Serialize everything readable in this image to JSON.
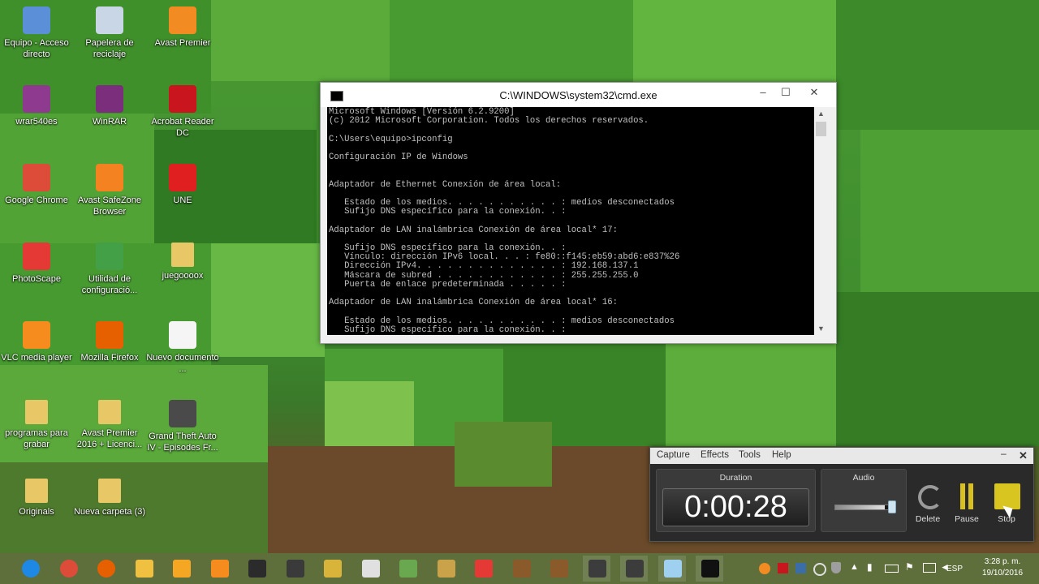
{
  "desktop": {
    "icons": [
      {
        "label": "Equipo - Acceso directo",
        "icon": "computer-icon",
        "color": "#5b8fd8"
      },
      {
        "label": "Papelera de reciclaje",
        "icon": "recycle-bin-icon",
        "color": "#c9d6e6"
      },
      {
        "label": "Avast Premier",
        "icon": "avast-icon",
        "color": "#f28b22"
      },
      {
        "label": "wrar540es",
        "icon": "winrar-installer-icon",
        "color": "#8e3b8f"
      },
      {
        "label": "WinRAR",
        "icon": "winrar-icon",
        "color": "#7a2e7c"
      },
      {
        "label": "Acrobat Reader DC",
        "icon": "acrobat-icon",
        "color": "#c9151e"
      },
      {
        "label": "Google Chrome",
        "icon": "chrome-icon",
        "color": "#dd4b39"
      },
      {
        "label": "Avast SafeZone Browser",
        "icon": "safezone-icon",
        "color": "#f58220"
      },
      {
        "label": "UNE",
        "icon": "une-icon",
        "color": "#e02020"
      },
      {
        "label": "PhotoScape",
        "icon": "photoscape-icon",
        "color": "#e53935"
      },
      {
        "label": "Utilidad de configuració...",
        "icon": "wifi-utility-icon",
        "color": "#43a047"
      },
      {
        "label": "juegoooox",
        "icon": "folder-icon",
        "color": "#e8c766"
      },
      {
        "label": "VLC media player",
        "icon": "vlc-icon",
        "color": "#f78c1e"
      },
      {
        "label": "Mozilla Firefox",
        "icon": "firefox-icon",
        "color": "#e66000"
      },
      {
        "label": "Nuevo documento ...",
        "icon": "text-document-icon",
        "color": "#f5f5f5"
      },
      {
        "label": "programas para grabar",
        "icon": "folder-icon",
        "color": "#e8c766"
      },
      {
        "label": "Avast Premier 2016 + Licenci...",
        "icon": "folder-icon",
        "color": "#e8c766"
      },
      {
        "label": "Grand Theft Auto IV - Episodes Fr...",
        "icon": "gta-icon",
        "color": "#4a4a4a"
      },
      {
        "label": "Originals",
        "icon": "folder-icon",
        "color": "#e8c766"
      },
      {
        "label": "Nueva carpeta (3)",
        "icon": "folder-icon",
        "color": "#e8c766"
      }
    ]
  },
  "cmd": {
    "title": "C:\\WINDOWS\\system32\\cmd.exe",
    "minimize": "‒",
    "maximize": "☐",
    "close": "✕",
    "lines": [
      "Microsoft Windows [Versión 6.2.9200]",
      "(c) 2012 Microsoft Corporation. Todos los derechos reservados.",
      "",
      "C:\\Users\\equipo>ipconfig",
      "",
      "Configuración IP de Windows",
      "",
      "",
      "Adaptador de Ethernet Conexión de área local:",
      "",
      "   Estado de los medios. . . . . . . . . . . : medios desconectados",
      "   Sufijo DNS específico para la conexión. . :",
      "",
      "Adaptador de LAN inalámbrica Conexión de área local* 17:",
      "",
      "   Sufijo DNS específico para la conexión. . :",
      "   Vínculo: dirección IPv6 local. . . : fe80::f145:eb59:abd6:e837%26",
      "   Dirección IPv4. . . . . . . . . . . . . . : 192.168.137.1",
      "   Máscara de subred . . . . . . . . . . . . : 255.255.255.0",
      "   Puerta de enlace predeterminada . . . . . :",
      "",
      "Adaptador de LAN inalámbrica Conexión de área local* 16:",
      "",
      "   Estado de los medios. . . . . . . . . . . : medios desconectados",
      "   Sufijo DNS específico para la conexión. . :"
    ]
  },
  "recorder": {
    "menu": [
      "Capture",
      "Effects",
      "Tools",
      "Help"
    ],
    "minimize": "‒",
    "close": "✕",
    "duration_label": "Duration",
    "duration": "0:00:28",
    "audio_label": "Audio",
    "audio_level": 0.85,
    "delete_label": "Delete",
    "pause_label": "Pause",
    "stop_label": "Stop"
  },
  "taskbar": {
    "apps": [
      {
        "icon": "internet-explorer-icon",
        "color": "#1e88e5"
      },
      {
        "icon": "chrome-icon",
        "color": "#dd4b39"
      },
      {
        "icon": "firefox-icon",
        "color": "#e66000"
      },
      {
        "icon": "file-explorer-icon",
        "color": "#f0c040"
      },
      {
        "icon": "media-player-icon",
        "color": "#f5a623"
      },
      {
        "icon": "vlc-icon",
        "color": "#f78c1e"
      },
      {
        "icon": "game-dark-icon",
        "color": "#2b2b2b"
      },
      {
        "icon": "game-assassin-icon",
        "color": "#3a3a3a"
      },
      {
        "icon": "game-fifa-icon",
        "color": "#d9b43a"
      },
      {
        "icon": "skull-icon",
        "color": "#e0e0e0"
      },
      {
        "icon": "minecraft-icon",
        "color": "#6aa84f"
      },
      {
        "icon": "game-ring-icon",
        "color": "#caa24a"
      },
      {
        "icon": "photoscape-icon",
        "color": "#e53935"
      },
      {
        "icon": "crafting-table-icon",
        "color": "#8b5a2b"
      },
      {
        "icon": "crafting-table-icon",
        "color": "#8b5a2b"
      },
      {
        "icon": "recorder-icon",
        "color": "#3c3c3c"
      },
      {
        "icon": "recorder-active-icon",
        "color": "#3c3c3c"
      },
      {
        "icon": "crystal-icon",
        "color": "#9fd0f0"
      },
      {
        "icon": "command-prompt-icon",
        "color": "#111111"
      }
    ],
    "language": "ESP",
    "time": "3:28 p. m.",
    "date": "19/10/2016"
  }
}
